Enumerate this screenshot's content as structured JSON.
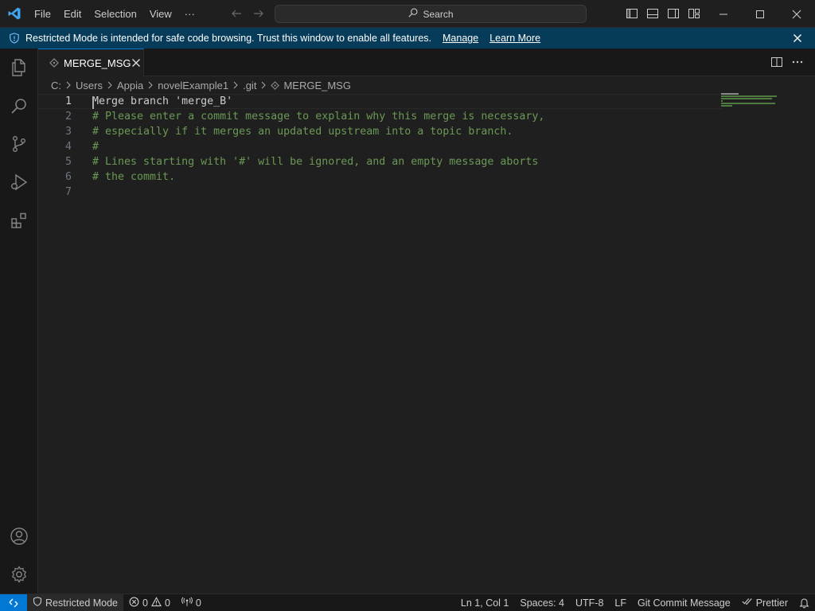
{
  "titlebar": {
    "menu": [
      "File",
      "Edit",
      "Selection",
      "View",
      "···"
    ],
    "search_label": "Search"
  },
  "banner": {
    "message": "Restricted Mode is intended for safe code browsing. Trust this window to enable all features.",
    "manage_label": "Manage",
    "learn_more_label": "Learn More",
    "background": "#063b5a"
  },
  "tabs": [
    {
      "label": "MERGE_MSG",
      "active": true
    }
  ],
  "breadcrumb": [
    "C:",
    "Users",
    "Appia",
    "novelExample1",
    ".git",
    "MERGE_MSG"
  ],
  "editor": {
    "lines": [
      {
        "number": "1",
        "text": "Merge branch 'merge_B'",
        "kind": "normal"
      },
      {
        "number": "2",
        "text": "# Please enter a commit message to explain why this merge is necessary,",
        "kind": "comment"
      },
      {
        "number": "3",
        "text": "# especially if it merges an updated upstream into a topic branch.",
        "kind": "comment"
      },
      {
        "number": "4",
        "text": "#",
        "kind": "comment"
      },
      {
        "number": "5",
        "text": "# Lines starting with '#' will be ignored, and an empty message aborts",
        "kind": "comment"
      },
      {
        "number": "6",
        "text": "# the commit.",
        "kind": "comment"
      },
      {
        "number": "7",
        "text": "",
        "kind": "normal"
      }
    ],
    "comment_color": "#6a9955",
    "text_color": "#cccccc"
  },
  "statusbar": {
    "restricted_label": "Restricted Mode",
    "errors": "0",
    "warnings": "0",
    "ports": "0",
    "position": "Ln 1, Col 1",
    "spaces": "Spaces: 4",
    "encoding": "UTF-8",
    "eol": "LF",
    "language": "Git Commit Message",
    "formatter": "Prettier",
    "accent": "#0078d4"
  }
}
